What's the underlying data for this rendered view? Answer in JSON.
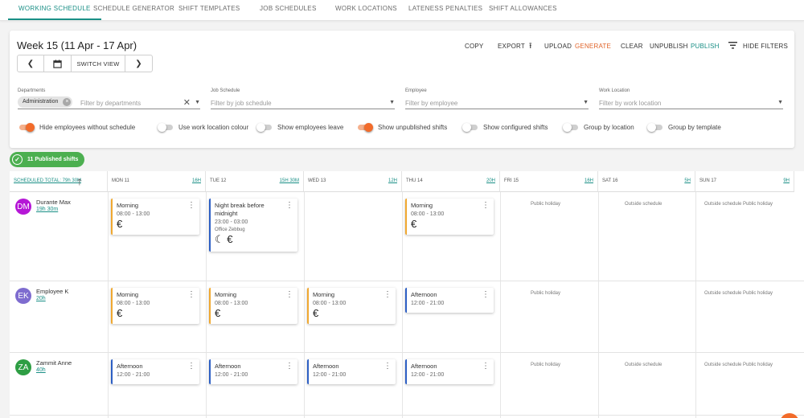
{
  "tabs": [
    "WORKING SCHEDULE",
    "SCHEDULE GENERATOR",
    "SHIFT TEMPLATES",
    "JOB SCHEDULES",
    "WORK LOCATIONS",
    "LATENESS PENALTIES",
    "SHIFT ALLOWANCES"
  ],
  "header": {
    "week_title": "Week 15 (11 Apr - 17 Apr)",
    "switch_view": "SWITCH VIEW"
  },
  "actions": {
    "copy": "COPY",
    "export": "EXPORT",
    "upload": "UPLOAD",
    "generate": "GENERATE",
    "clear": "CLEAR",
    "unpublish": "UNPUBLISH",
    "publish": "PUBLISH",
    "hide_filters": "HIDE FILTERS"
  },
  "filters": {
    "departments": {
      "label": "Departments",
      "chip": "Administration",
      "placeholder": "Filter by departments"
    },
    "job_schedule": {
      "label": "Job Schedule",
      "placeholder": "Filter by job schedule"
    },
    "employee": {
      "label": "Employee",
      "placeholder": "Filter by employee"
    },
    "work_location": {
      "label": "Work Location",
      "placeholder": "Filter by work location"
    }
  },
  "toggles": [
    {
      "label": "Hide employees without schedule",
      "on": true
    },
    {
      "label": "Use work location colour",
      "on": false
    },
    {
      "label": "Show employees leave",
      "on": false
    },
    {
      "label": "Show unpublished shifts",
      "on": true
    },
    {
      "label": "Show configured shifts",
      "on": false
    },
    {
      "label": "Group by location",
      "on": false
    },
    {
      "label": "Group by template",
      "on": false
    }
  ],
  "published_badge": "11 Published shifts",
  "grid": {
    "scheduled_total": "SCHEDULED TOTAL: 79h 30M",
    "days": [
      {
        "name": "MON 11",
        "total": "16H"
      },
      {
        "name": "TUE 12",
        "total": "15H 30M"
      },
      {
        "name": "WED 13",
        "total": "12H"
      },
      {
        "name": "THU 14",
        "total": "20H"
      },
      {
        "name": "FRI 15",
        "total": "16H"
      },
      {
        "name": "SAT 16",
        "total": "5H"
      },
      {
        "name": "SUN 17",
        "total": "9H"
      }
    ],
    "employees": [
      {
        "initials": "DM",
        "name": "Durante Max",
        "hours": "19h 30m",
        "color": "#b517d6"
      },
      {
        "initials": "EK",
        "name": "Employee K",
        "hours": "20h",
        "color": "#7e6ccf"
      },
      {
        "initials": "ZA",
        "name": "Zammit Anne",
        "hours": "40h",
        "color": "#2e9e44"
      }
    ],
    "shifts": [
      {
        "name": "Morning",
        "time": "08:00 - 13:00",
        "icons": "€"
      },
      {
        "name": "Night break before midnight",
        "time": "23:00 - 03:00",
        "location": "Office Zebbug",
        "icons": "☾ €"
      },
      {
        "name": "Morning",
        "time": "08:00 - 13:00",
        "icons": "€"
      },
      {
        "name": "Morning",
        "time": "08:00 - 13:00",
        "icons": "€"
      },
      {
        "name": "Morning",
        "time": "08:00 - 13:00",
        "icons": "€"
      },
      {
        "name": "Morning",
        "time": "08:00 - 13:00",
        "icons": "€"
      },
      {
        "name": "Afternoon",
        "time": "12:00 - 21:00"
      },
      {
        "name": "Afternoon",
        "time": "12:00 - 21:00"
      },
      {
        "name": "Afternoon",
        "time": "12:00 - 21:00"
      },
      {
        "name": "Afternoon",
        "time": "12:00 - 21:00"
      },
      {
        "name": "Afternoon",
        "time": "12:00 - 21:00"
      }
    ],
    "notes": {
      "public_holiday": "Public holiday",
      "outside_schedule": "Outside schedule",
      "outside_public": "Outside schedule Public holiday"
    }
  }
}
